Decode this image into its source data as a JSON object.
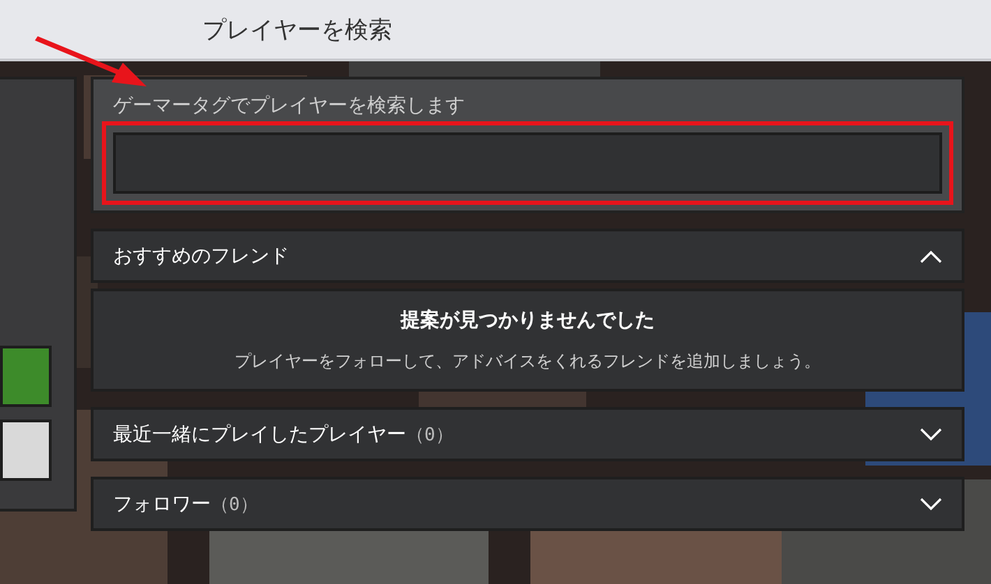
{
  "window": {
    "title": "プレイヤーを検索"
  },
  "search": {
    "label": "ゲーマータグでプレイヤーを検索します",
    "highlighted": true
  },
  "sections": [
    {
      "title": "おすすめのフレンド",
      "expanded": true,
      "empty_title": "提案が見つかりませんでした",
      "empty_text": "プレイヤーをフォローして、アドバイスをくれるフレンドを追加しましょう。"
    },
    {
      "title": "最近一緒にプレイしたプレイヤー",
      "count": "（0）",
      "expanded": false
    },
    {
      "title": "フォロワー",
      "count": "（0）",
      "expanded": false
    }
  ]
}
